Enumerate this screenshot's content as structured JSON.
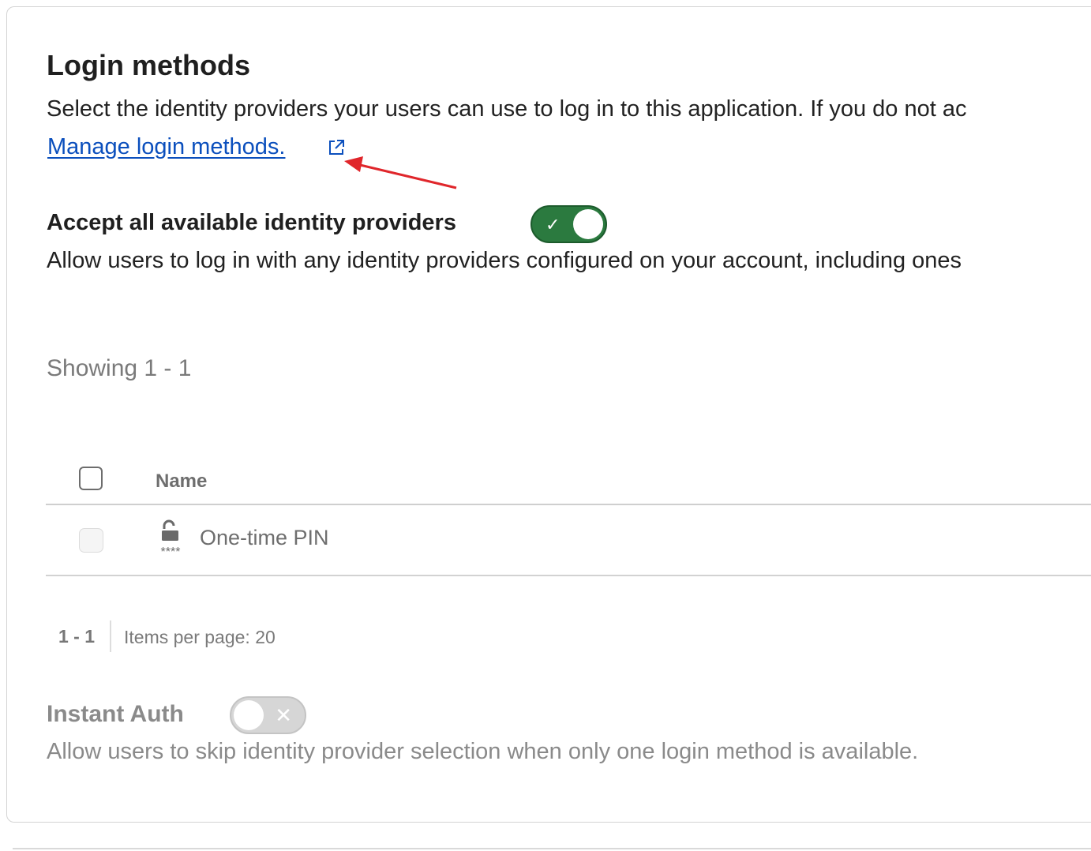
{
  "section": {
    "title": "Login methods",
    "description": "Select the identity providers your users can use to log in to this application. If you do not ac",
    "manage_link": "Manage login methods."
  },
  "accept_all": {
    "label": "Accept all available identity providers",
    "enabled": true,
    "description": "Allow users to log in with any identity providers configured on your account, including ones"
  },
  "table": {
    "showing": "Showing 1 - 1",
    "columns": [
      "Name"
    ],
    "rows": [
      {
        "name": "One-time PIN",
        "icon": "unlock-pin-icon",
        "icon_caption": "****",
        "disabled": true
      }
    ]
  },
  "pagination": {
    "range": "1 - 1",
    "items_per_page": "Items per page: 20"
  },
  "instant_auth": {
    "label": "Instant Auth",
    "enabled": false,
    "description": "Allow users to skip identity provider selection when only one login method is available."
  },
  "colors": {
    "link": "#0b4fbd",
    "toggle_on": "#2b7a3f",
    "annotation_arrow": "#e0262b"
  }
}
